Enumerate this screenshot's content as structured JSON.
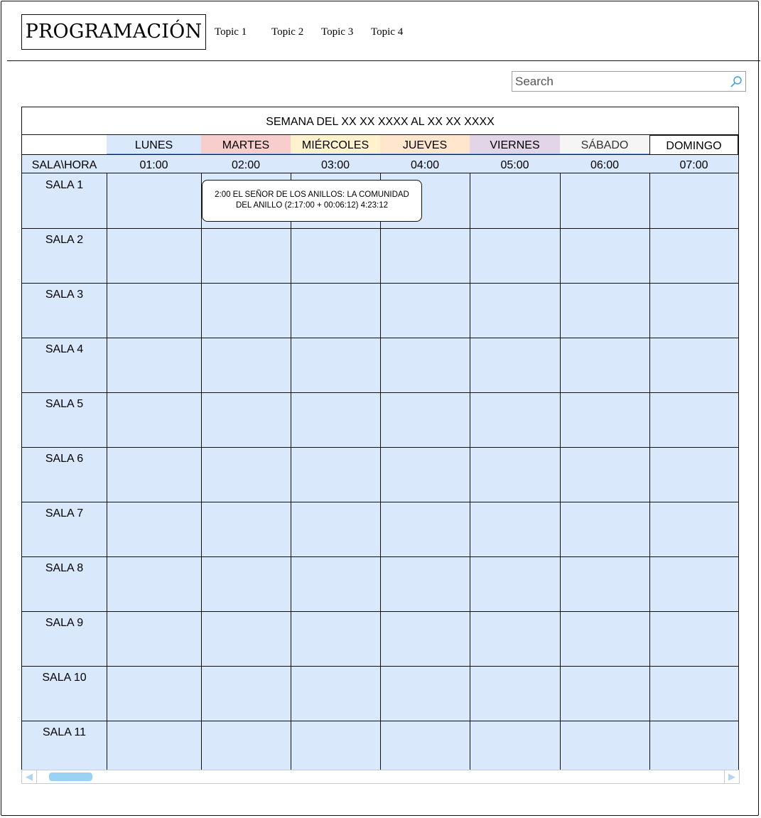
{
  "header": {
    "logo": "PROGRAMACIÓN",
    "topics": [
      "Topic 1",
      "Topic 2",
      "Topic 3",
      "Topic 4"
    ]
  },
  "search": {
    "placeholder": "Search",
    "value": ""
  },
  "schedule": {
    "week_title": "SEMANA DEL XX XX XXXX AL XX XX XXXX",
    "days": [
      {
        "label": "LUNES",
        "bg": "#dae8fc"
      },
      {
        "label": "MARTES",
        "bg": "#f8cecc"
      },
      {
        "label": "MIÉRCOLES",
        "bg": "#fff2cc"
      },
      {
        "label": "JUEVES",
        "bg": "#ffe6cc"
      },
      {
        "label": "VIERNES",
        "bg": "#e1d5e7"
      },
      {
        "label": "SÁBADO",
        "bg": "#f5f5f5",
        "color": "#333333"
      },
      {
        "label": "DOMINGO",
        "bg": "#ffffff"
      }
    ],
    "corner_label": "SALA\\HORA",
    "hours": [
      "01:00",
      "02:00",
      "03:00",
      "04:00",
      "05:00",
      "06:00",
      "07:00"
    ],
    "rooms": [
      "SALA 1",
      "SALA 2",
      "SALA 3",
      "SALA 4",
      "SALA 5",
      "SALA 6",
      "SALA 7",
      "SALA 8",
      "SALA 9",
      "SALA 10",
      "SALA 11"
    ],
    "events": [
      {
        "line1": "2:00 EL SEÑOR DE LOS ANILLOS: LA COMUNIDAD",
        "line2": "DEL ANILLO (2:17:00 + 00:06:12) 4:23:12"
      }
    ]
  },
  "colors": {
    "grid_fill": "#dae8fc",
    "scroll_accent": "#99d2f5"
  }
}
